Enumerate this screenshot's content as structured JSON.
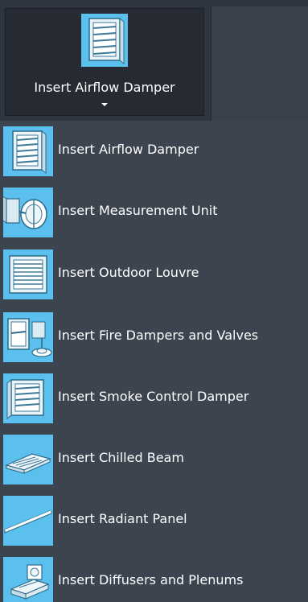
{
  "split_button": {
    "label": "Insert Airflow Damper",
    "icon": "airflow-damper-icon"
  },
  "menu": {
    "items": [
      {
        "label": "Insert Airflow Damper",
        "icon": "airflow-damper-icon"
      },
      {
        "label": "Insert Measurement Unit",
        "icon": "measurement-unit-icon"
      },
      {
        "label": "Insert Outdoor Louvre",
        "icon": "outdoor-louvre-icon"
      },
      {
        "label": "Insert Fire Dampers and Valves",
        "icon": "fire-damper-icon"
      },
      {
        "label": "Insert Smoke Control Damper",
        "icon": "smoke-control-damper-icon"
      },
      {
        "label": "Insert Chilled Beam",
        "icon": "chilled-beam-icon"
      },
      {
        "label": "Insert Radiant Panel",
        "icon": "radiant-panel-icon"
      },
      {
        "label": "Insert Diffusers and Plenums",
        "icon": "diffuser-plenum-icon"
      }
    ]
  },
  "colors": {
    "icon_background": "#5bc0ee",
    "menu_background": "#3c4450",
    "ribbon_background": "#2f3540",
    "text": "#ffffff"
  }
}
